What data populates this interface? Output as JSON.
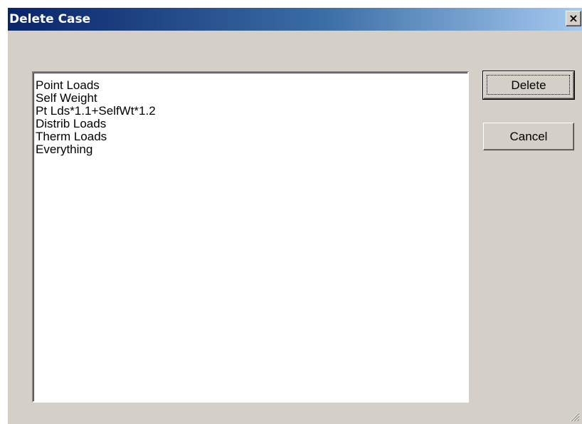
{
  "dialog": {
    "title": "Delete Case",
    "close_glyph": "×",
    "close_icon": "close-icon",
    "grip_icon": "resize-grip-icon"
  },
  "case_list": {
    "items": [
      "Point Loads",
      "Self Weight",
      "Pt Lds*1.1+SelfWt*1.2",
      "Distrib Loads",
      "Therm Loads",
      "Everything"
    ]
  },
  "buttons": {
    "delete_label": "Delete",
    "cancel_label": "Cancel"
  },
  "colors": {
    "titlebar_start": "#0a246a",
    "titlebar_end": "#a6caf0",
    "dialog_face": "#d4d0c8",
    "list_background": "#ffffff"
  }
}
